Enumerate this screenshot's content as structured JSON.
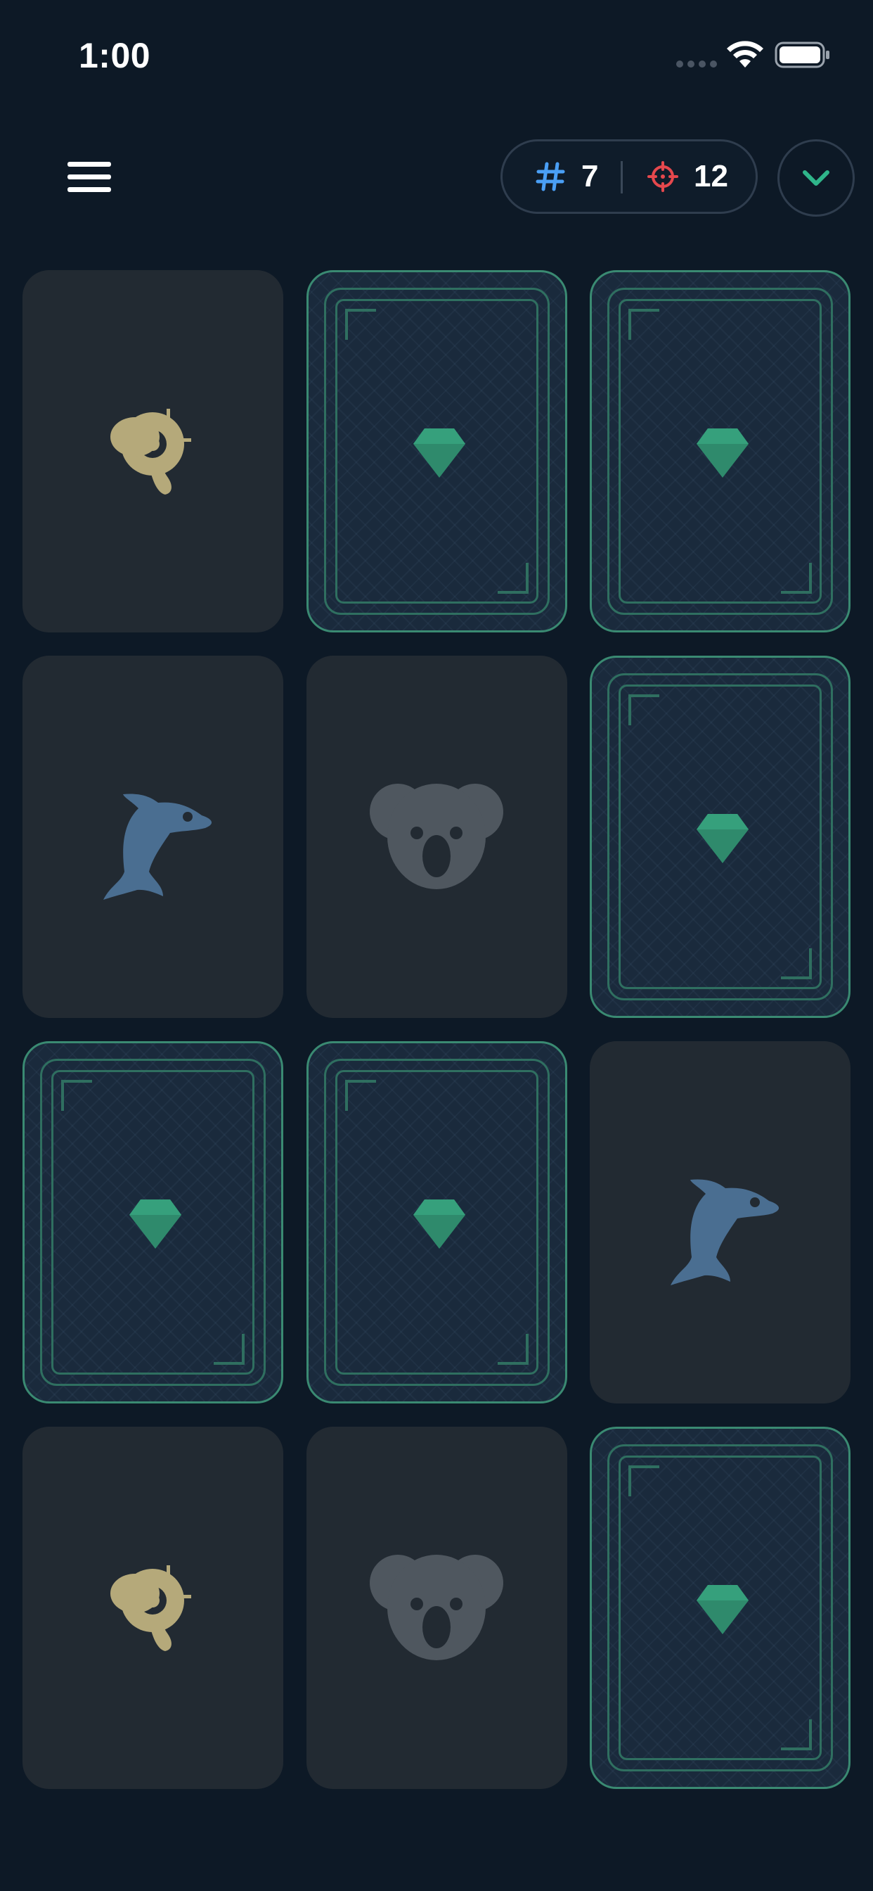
{
  "status_bar": {
    "time": "1:00",
    "signal_icon": "cellular-signal-icon",
    "wifi_icon": "wifi-icon",
    "battery_icon": "battery-full-icon"
  },
  "header": {
    "menu_icon": "hamburger-menu-icon",
    "moves": {
      "icon": "hash-icon",
      "value": "7",
      "color": "#4a9ff5"
    },
    "target": {
      "icon": "crosshair-icon",
      "value": "12",
      "color": "#e5484d"
    },
    "collapse_icon": "chevron-down-icon",
    "accent_color": "#2fb58a"
  },
  "board": {
    "rows": 4,
    "columns": 3,
    "card_back_icon": "gem-icon",
    "cards": [
      {
        "state": "face",
        "symbol": "snail",
        "icon": "snail-icon",
        "color": "#b5a97a"
      },
      {
        "state": "back"
      },
      {
        "state": "back"
      },
      {
        "state": "face",
        "symbol": "dolphin",
        "icon": "dolphin-icon",
        "color": "#4a6e91"
      },
      {
        "state": "face",
        "symbol": "koala",
        "icon": "koala-icon",
        "color": "#4f575f"
      },
      {
        "state": "back"
      },
      {
        "state": "back"
      },
      {
        "state": "back"
      },
      {
        "state": "face",
        "symbol": "dolphin",
        "icon": "dolphin-icon",
        "color": "#4a6e91"
      },
      {
        "state": "face",
        "symbol": "snail",
        "icon": "snail-icon",
        "color": "#b5a97a"
      },
      {
        "state": "face",
        "symbol": "koala",
        "icon": "koala-icon",
        "color": "#4f575f"
      },
      {
        "state": "back"
      }
    ]
  }
}
